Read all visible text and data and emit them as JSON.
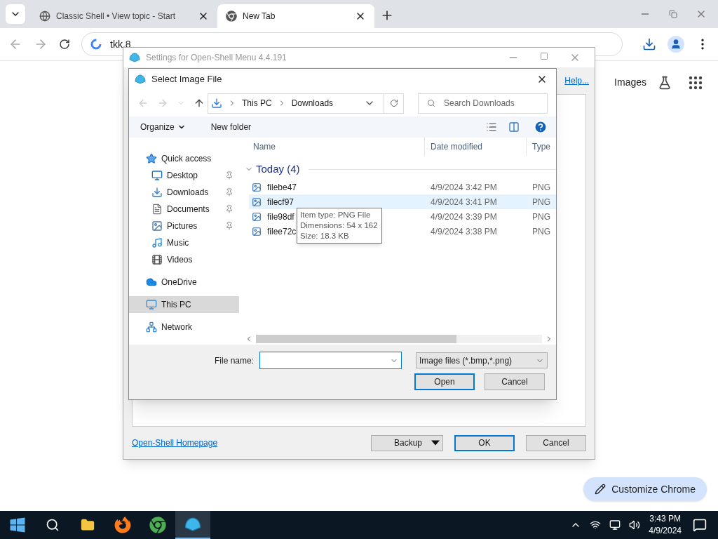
{
  "browser": {
    "tabs": [
      {
        "title": "Classic Shell • View topic - Start",
        "selected": false,
        "kind": "web"
      },
      {
        "title": "New Tab",
        "selected": true,
        "kind": "newtab"
      }
    ],
    "address": "tkk.8"
  },
  "page": {
    "images_link": "Images",
    "customize_button": "Customize Chrome"
  },
  "settings_window": {
    "title": "Settings for Open-Shell Menu 4.4.191",
    "help_link": "Help...",
    "homepage_link": "Open-Shell Homepage",
    "buttons": [
      {
        "label": "Backup",
        "kind": "split",
        "default": false
      },
      {
        "label": "OK",
        "kind": "plain",
        "default": true
      },
      {
        "label": "Cancel",
        "kind": "plain",
        "default": false
      }
    ]
  },
  "dialog": {
    "title": "Select Image File",
    "path": [
      "This PC",
      "Downloads"
    ],
    "search_placeholder": "Search Downloads",
    "toolbar": [
      "Organize",
      "New folder"
    ],
    "nav": [
      {
        "label": "Quick access",
        "kind": "star",
        "selected": false,
        "children": [
          {
            "label": "Desktop",
            "kind": "desktop",
            "pinned": true,
            "selected": false
          },
          {
            "label": "Downloads",
            "kind": "download",
            "pinned": true,
            "selected": false
          },
          {
            "label": "Documents",
            "kind": "document",
            "pinned": true,
            "selected": false
          },
          {
            "label": "Pictures",
            "kind": "picture",
            "pinned": true,
            "selected": false
          },
          {
            "label": "Music",
            "kind": "music",
            "pinned": false,
            "selected": false
          },
          {
            "label": "Videos",
            "kind": "video",
            "pinned": false,
            "selected": false
          }
        ]
      },
      {
        "label": "OneDrive",
        "kind": "cloud",
        "selected": false
      },
      {
        "label": "This PC",
        "kind": "pc",
        "selected": true
      },
      {
        "label": "Network",
        "kind": "network",
        "selected": false
      }
    ],
    "columns": [
      "Name",
      "Date modified",
      "Type"
    ],
    "group": "Today (4)",
    "files": [
      {
        "name": "filebe47",
        "date": "4/9/2024 3:42 PM",
        "type": "PNG",
        "highlighted": false
      },
      {
        "name": "filecf97",
        "date": "4/9/2024 3:41 PM",
        "type": "PNG",
        "highlighted": true
      },
      {
        "name": "file98df",
        "date": "4/9/2024 3:39 PM",
        "type": "PNG",
        "highlighted": false
      },
      {
        "name": "filee72c",
        "date": "4/9/2024 3:38 PM",
        "type": "PNG",
        "highlighted": false
      }
    ],
    "tooltip": [
      "Item type: PNG File",
      "Dimensions: 54 x 162",
      "Size: 18.3 KB"
    ],
    "file_name_label": "File name:",
    "filter": "Image files (*.bmp,*.png)",
    "buttons": [
      {
        "label": "Open",
        "default": true
      },
      {
        "label": "Cancel",
        "default": false
      }
    ]
  },
  "taskbar": {
    "apps": [
      {
        "kind": "start",
        "active": false
      },
      {
        "kind": "search",
        "active": false
      },
      {
        "kind": "explorer",
        "active": false
      },
      {
        "kind": "firefox",
        "active": false
      },
      {
        "kind": "chrome",
        "active": false
      },
      {
        "kind": "shell",
        "active": true
      }
    ],
    "time": "3:43 PM",
    "date": "4/9/2024"
  }
}
